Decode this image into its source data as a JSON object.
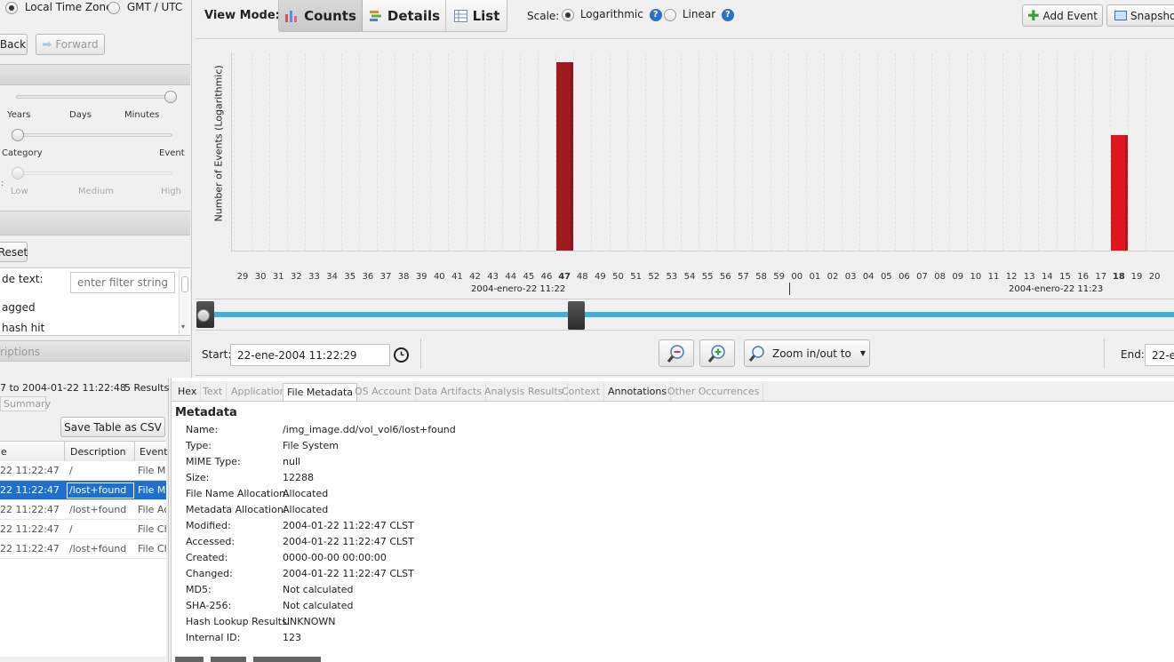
{
  "timezone": {
    "local_label": "Local Time Zone",
    "gmt_label": "GMT / UTC",
    "selected": "local"
  },
  "nav": {
    "back_label": "Back",
    "forward_label": "Forward"
  },
  "zoom_panel": {
    "scale1": [
      "Years",
      "Days",
      "Minutes"
    ],
    "scale2": [
      "Category",
      "Event"
    ],
    "scale3": [
      "Low",
      "Medium",
      "High"
    ],
    "prefix3": ":"
  },
  "filters": {
    "reset_label": "Reset",
    "text_filter_label": "de text:",
    "filter_placeholder": "enter filter string",
    "tagged_label": "agged",
    "hash_label": " hash hit",
    "descriptions_header": "riptions"
  },
  "results": {
    "range_text": "7 to 2004-01-22 11:22:48",
    "count_text": "5  Results",
    "summary_tab": "Summary",
    "save_csv_label": "Save Table as CSV",
    "columns": [
      "e",
      "Description",
      "Event"
    ],
    "rows": [
      {
        "time": "22 11:22:47",
        "desc": "/",
        "event": "File Mo"
      },
      {
        "time": "22 11:22:47",
        "desc": "/lost+found",
        "event": "File Mo",
        "selected": true
      },
      {
        "time": "22 11:22:47",
        "desc": "/lost+found",
        "event": "File Ac"
      },
      {
        "time": "22 11:22:47",
        "desc": "/",
        "event": "File Ch"
      },
      {
        "time": "22 11:22:47",
        "desc": "/lost+found",
        "event": "File Ch"
      }
    ]
  },
  "toolbar": {
    "view_mode_label": "View Mode:",
    "counts_label": "Counts",
    "details_label": "Details",
    "list_label": "List",
    "scale_label": "Scale:",
    "log_label": "Logarithmic",
    "linear_label": "Linear",
    "add_event_label": "Add Event",
    "snapshot_label": "Snapshot"
  },
  "chart_data": {
    "type": "bar",
    "ylabel": "Number of Events (Logarithmic)",
    "scale": "logarithmic",
    "x": [
      "29",
      "30",
      "31",
      "32",
      "33",
      "34",
      "35",
      "36",
      "37",
      "38",
      "39",
      "40",
      "41",
      "42",
      "43",
      "44",
      "45",
      "46",
      "47",
      "48",
      "49",
      "50",
      "51",
      "52",
      "53",
      "54",
      "55",
      "56",
      "57",
      "58",
      "59",
      "00",
      "01",
      "02",
      "03",
      "04",
      "05",
      "06",
      "07",
      "08",
      "09",
      "10",
      "11",
      "12",
      "13",
      "14",
      "15",
      "16",
      "17",
      "18",
      "19",
      "20"
    ],
    "bold_ticks": [
      "47",
      "18"
    ],
    "bars": [
      {
        "x": "47",
        "value": 5,
        "color": "#a11a1f"
      },
      {
        "x": "18",
        "value": 2,
        "color": "#e0161f"
      }
    ],
    "group_labels": [
      "2004-enero-22 11:22",
      "2004-enero-22 11:23"
    ],
    "grid": true
  },
  "range": {
    "start_label": "Start:",
    "start_value": "22-ene-2004 11:22:29",
    "end_label": "End:",
    "end_value": "22-e",
    "zoom_to_label": "Zoom in/out to"
  },
  "detail_tabs": [
    "Hex",
    "Text",
    "Application",
    "File Metadata",
    "OS Account",
    "Data Artifacts",
    "Analysis Results",
    "Context",
    "Annotations",
    "Other Occurrences"
  ],
  "metadata": {
    "title": "Metadata",
    "rows": [
      {
        "k": "Name:",
        "v": "/img_image.dd/vol_vol6/lost+found"
      },
      {
        "k": "Type:",
        "v": "File System"
      },
      {
        "k": "MIME Type:",
        "v": "null"
      },
      {
        "k": "Size:",
        "v": "12288"
      },
      {
        "k": "File Name Allocation:",
        "v": "Allocated"
      },
      {
        "k": "Metadata Allocation:",
        "v": "Allocated"
      },
      {
        "k": "Modified:",
        "v": "2004-01-22 11:22:47 CLST"
      },
      {
        "k": "Accessed:",
        "v": "2004-01-22 11:22:47 CLST"
      },
      {
        "k": "Created:",
        "v": "0000-00-00 00:00:00"
      },
      {
        "k": "Changed:",
        "v": "2004-01-22 11:22:47 CLST"
      },
      {
        "k": "MD5:",
        "v": "Not calculated"
      },
      {
        "k": "SHA-256:",
        "v": "Not calculated"
      },
      {
        "k": "Hash Lookup Results:",
        "v": "UNKNOWN"
      },
      {
        "k": "Internal ID:",
        "v": "123"
      }
    ]
  }
}
